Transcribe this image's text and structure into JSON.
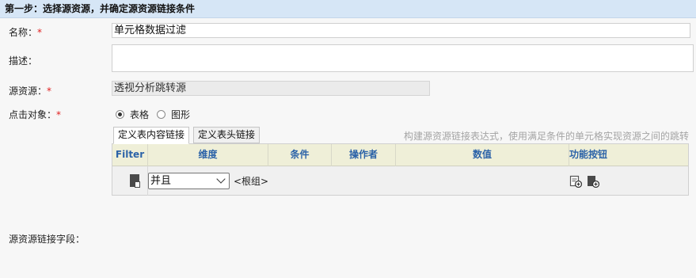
{
  "step": {
    "title": "第一步：选择源资源，并确定源资源链接条件"
  },
  "form": {
    "name_label": "名称：",
    "name_value": "单元格数据过滤",
    "desc_label": "描述：",
    "desc_value": "",
    "source_label": "源资源：",
    "source_value": "透视分析跳转源",
    "click_label": "点击对象：",
    "required_mark": "*",
    "radio_table": "表格",
    "radio_chart": "图形",
    "link_field_label": "源资源链接字段："
  },
  "tabs": [
    {
      "label": "定义表内容链接",
      "active": true
    },
    {
      "label": "定义表头链接",
      "active": false
    }
  ],
  "hint": "构建源资源链接表达式，使用满足条件的单元格实现资源之间的跳转",
  "grid": {
    "headers": [
      "Filter",
      "维度",
      "条件",
      "操作者",
      "数值",
      "功能按钮"
    ],
    "row": {
      "logic": "并且",
      "root": "<根组>"
    }
  },
  "colors": {
    "header_bg": "#d6e6f6",
    "grid_head_bg": "#efefd8",
    "grid_head_text": "#2c63a8",
    "required": "#e02020"
  },
  "icons": [
    "doc-icon",
    "chevron-down-icon",
    "add-condition-icon",
    "add-group-icon"
  ]
}
